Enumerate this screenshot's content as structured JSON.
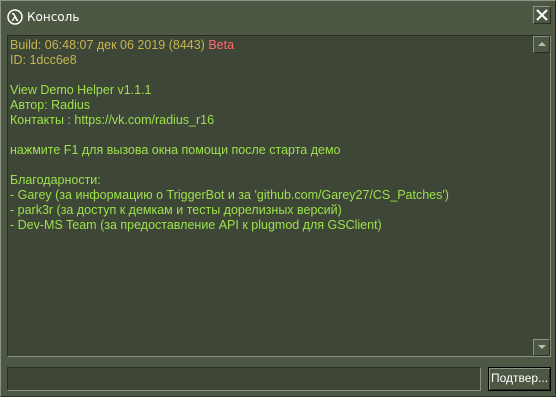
{
  "window": {
    "title": "Консоль",
    "title_icon": "half-life-lambda-icon",
    "close_icon": "close-icon"
  },
  "console": {
    "lines": [
      {
        "text": "Build: 06:48:07 дек 06 2019 (8443) ",
        "suffix": "Beta",
        "color": "#c4b550",
        "suffix_color": "#ff6a6a"
      },
      {
        "text": "ID: 1dcc6e8",
        "color": "#c4b550"
      },
      {
        "text": "",
        "color": "#9ce14c"
      },
      {
        "text": "View Demo Helper v1.1.1",
        "color": "#9ce14c"
      },
      {
        "text": "Автор: Radius",
        "color": "#9ce14c"
      },
      {
        "text": "Контакты : https://vk.com/radius_r16",
        "color": "#9ce14c"
      },
      {
        "text": "",
        "color": "#9ce14c"
      },
      {
        "text": "нажмите F1 для вызова окна помощи после старта демо",
        "color": "#9ce14c"
      },
      {
        "text": "",
        "color": "#9ce14c"
      },
      {
        "text": "Благодарности:",
        "color": "#9ce14c"
      },
      {
        "text": "- Garey (за информацию о TriggerBot и за 'github.com/Garey27/CS_Patches')",
        "color": "#9ce14c"
      },
      {
        "text": "- park3r (за доступ к демкам и тесты дорелизных версий)",
        "color": "#9ce14c"
      },
      {
        "text": "- Dev-MS Team (за предоставление API к plugmod для GSClient)",
        "color": "#9ce14c"
      }
    ],
    "scroll_up_icon": "arrow-up-icon",
    "scroll_down_icon": "arrow-down-icon"
  },
  "input": {
    "value": "",
    "placeholder": ""
  },
  "submit": {
    "label": "Подтвер..."
  },
  "colors": {
    "window_bg": "#4c5844",
    "console_bg": "#3e4637",
    "text_yellow": "#c4b550",
    "text_red": "#ff6a6a",
    "text_green": "#9ce14c"
  }
}
